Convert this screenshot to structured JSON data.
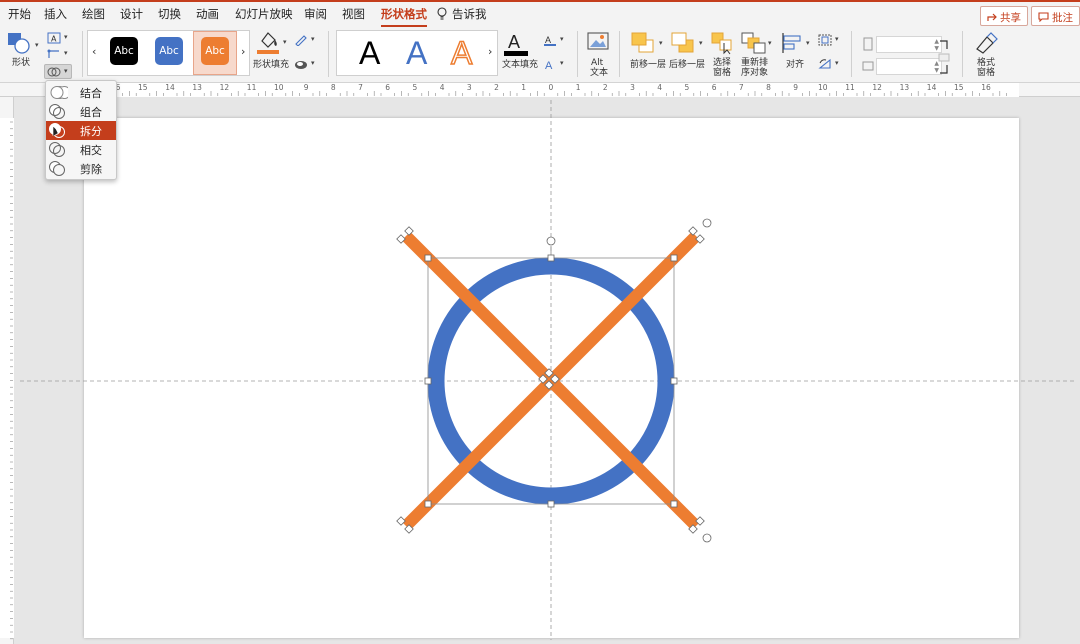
{
  "menu": {
    "tabs": [
      {
        "label": "开始"
      },
      {
        "label": "插入"
      },
      {
        "label": "绘图"
      },
      {
        "label": "设计"
      },
      {
        "label": "切换"
      },
      {
        "label": "动画"
      },
      {
        "label": "幻灯片放映"
      },
      {
        "label": "审阅"
      },
      {
        "label": "视图"
      },
      {
        "label": "形状格式"
      }
    ],
    "active_tab": "形状格式",
    "tell_me": "告诉我",
    "share": "共享",
    "comments": "批注"
  },
  "ribbon": {
    "shapes_label": "形状",
    "style_previews": [
      "Abc",
      "Abc",
      "Abc"
    ],
    "shape_fill_label": "形状填充",
    "text_fill_label": "文本填充",
    "wordart": [
      "A",
      "A",
      "A"
    ],
    "alt_text_label_1": "Alt",
    "alt_text_label_2": "文本",
    "bring_forward": "前移一层",
    "send_backward": "后移一层",
    "selection_pane_1": "选择",
    "selection_pane_2": "窗格",
    "reorder_1": "重新排",
    "reorder_2": "序对象",
    "align": "对齐",
    "format_pane_1": "格式",
    "format_pane_2": "窗格"
  },
  "merge_menu": {
    "items": [
      {
        "label": "结合"
      },
      {
        "label": "组合"
      },
      {
        "label": "拆分"
      },
      {
        "label": "相交"
      },
      {
        "label": "剪除"
      }
    ],
    "selected": "拆分"
  },
  "ruler": {
    "ticks": [
      "16",
      "15",
      "14",
      "13",
      "12",
      "11",
      "10",
      "9",
      "8",
      "7",
      "6",
      "5",
      "4",
      "3",
      "2",
      "1",
      "0",
      "1",
      "2",
      "3",
      "4",
      "5",
      "6",
      "7",
      "8",
      "9",
      "10",
      "11",
      "12",
      "13",
      "14",
      "15",
      "16"
    ]
  },
  "colors": {
    "accent": "#c43e1c",
    "circle_blue": "#4472c4",
    "cross_orange": "#ed7d31",
    "style_black": "#000000",
    "style_blue": "#4472c4",
    "style_orange": "#ed7d31"
  }
}
